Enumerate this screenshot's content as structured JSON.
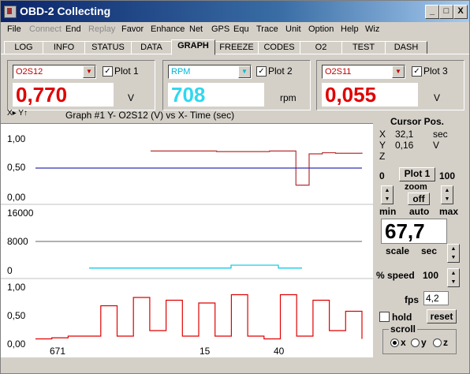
{
  "window": {
    "title": "OBD-2 Collecting",
    "min_label": "_",
    "max_label": "□",
    "close_label": "X"
  },
  "menu": [
    "File",
    "Connect",
    "End",
    "Replay",
    "Favor",
    "Enhance",
    "Net",
    "GPS",
    "Equ",
    "Trace",
    "Unit",
    "Option",
    "Help",
    "Wiz"
  ],
  "menu_disabled": [
    "Connect",
    "Replay"
  ],
  "tabs": [
    "LOG",
    "INFO",
    "STATUS",
    "DATA",
    "GRAPH",
    "FREEZE",
    "CODES",
    "O2",
    "TEST",
    "DASH"
  ],
  "active_tab": "GRAPH",
  "plots": [
    {
      "pid": "O2S12",
      "check": "✓",
      "label": "Plot 1",
      "value": "0,770",
      "unit": "V",
      "color": "#e00000"
    },
    {
      "pid": "RPM",
      "check": "✓",
      "label": "Plot 2",
      "value": "708",
      "unit": "rpm",
      "color": "#00c8e8"
    },
    {
      "pid": "O2S11",
      "check": "✓",
      "label": "Plot 3",
      "value": "0,055",
      "unit": "V",
      "color": "#e00000"
    }
  ],
  "graph": {
    "axis_icons": "X▸  Y↑",
    "title": "Graph #1   Y- O2S12 (V)  vs X- Time (sec)",
    "yticks1": [
      "1,00",
      "0,50",
      "0,00"
    ],
    "yticks2": [
      "16000",
      "8000",
      "0"
    ],
    "yticks3": [
      "1,00",
      "0,50",
      "0,00"
    ],
    "xticks": [
      "671",
      "15",
      "40"
    ]
  },
  "cursor": {
    "title": "Cursor Pos.",
    "x_label": "X",
    "x_value": "32,1",
    "x_unit": "sec",
    "y_label": "Y",
    "y_value": "0,16",
    "y_unit": "V",
    "z_label": "Z"
  },
  "zoom": {
    "min_num": "0",
    "plot_button": "Plot 1",
    "max_num": "100",
    "zoom_label": "zoom",
    "off_button": "off",
    "min_label": "min",
    "auto_label": "auto",
    "max_label": "max"
  },
  "scale": {
    "value": "67,7",
    "label": "scale",
    "unit": "sec"
  },
  "speed": {
    "label": "% speed",
    "value": "100"
  },
  "fps": {
    "label": "fps",
    "value": "4,2"
  },
  "hold": {
    "label": "hold"
  },
  "reset": {
    "label": "reset"
  },
  "scroll": {
    "label": "scroll",
    "options": [
      "x",
      "y",
      "z"
    ],
    "selected": "x"
  },
  "colors": {
    "o2s12_line": "#e00000",
    "o2s11_line": "#b83030",
    "blue_line": "#3030b0",
    "rpm_line": "#00c8e8",
    "gray_line": "#808080"
  },
  "chart_data": [
    {
      "type": "line",
      "xlabel": "Time (sec)",
      "ylabel": "O2S12 (V)",
      "ylim": [
        0,
        1
      ],
      "series": [
        {
          "values_note": "upper red trace",
          "values": [
            0.8,
            0.8,
            0.8,
            0.8,
            0.8,
            0.79,
            0.79,
            0.79,
            0.79,
            0.8,
            0.8,
            0.2,
            0.75,
            0.77,
            0.76,
            0.76,
            0.77
          ]
        },
        {
          "values": [
            0.5,
            0.5,
            0.5,
            0.5,
            0.5,
            0.5,
            0.5,
            0.5,
            0.5,
            0.5,
            0.5,
            0.5,
            0.5,
            0.5,
            0.5,
            0.5,
            0.5
          ]
        }
      ]
    },
    {
      "type": "line",
      "ylim": [
        0,
        16000
      ],
      "series": [
        {
          "values": [
            8000,
            8000,
            8000,
            8000,
            8000,
            8000,
            8000,
            8000,
            8000,
            8000
          ]
        },
        {
          "values": [
            708,
            708,
            708,
            708,
            708,
            708,
            1500,
            1500,
            708,
            708
          ]
        }
      ]
    },
    {
      "type": "line",
      "ylim": [
        0,
        1
      ],
      "series": [
        {
          "values": [
            0.05,
            0.07,
            0.1,
            0.1,
            0.65,
            0.1,
            0.8,
            0.2,
            0.75,
            0.1,
            0.7,
            0.1,
            0.85,
            0.1,
            0.05,
            0.85,
            0.1,
            0.75,
            0.2,
            0.55,
            0.05
          ]
        }
      ]
    }
  ]
}
